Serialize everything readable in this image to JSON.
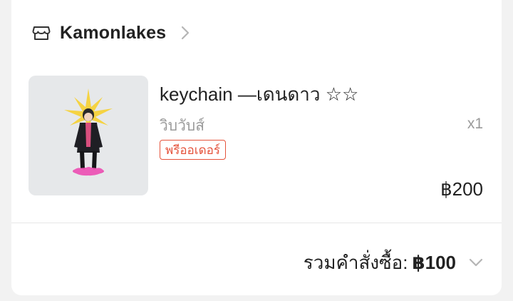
{
  "shop": {
    "name": "Kamonlakes",
    "icon": "store-icon",
    "chevron_icon": "chevron-right-icon"
  },
  "item": {
    "title": "keychain —เดนดาว ☆☆",
    "variant": "วิบวับส์",
    "quantity": "x1",
    "badge": "พรีออเดอร์",
    "price": "฿200"
  },
  "order": {
    "total_label": "รวมคำสั่งซื้อ:",
    "total_amount": "฿100",
    "expand_icon": "chevron-down-icon"
  },
  "colors": {
    "badge": "#e5533c",
    "text": "#222222",
    "muted": "#9a9a9a",
    "thumbnail_bg": "#e6e8ea"
  }
}
